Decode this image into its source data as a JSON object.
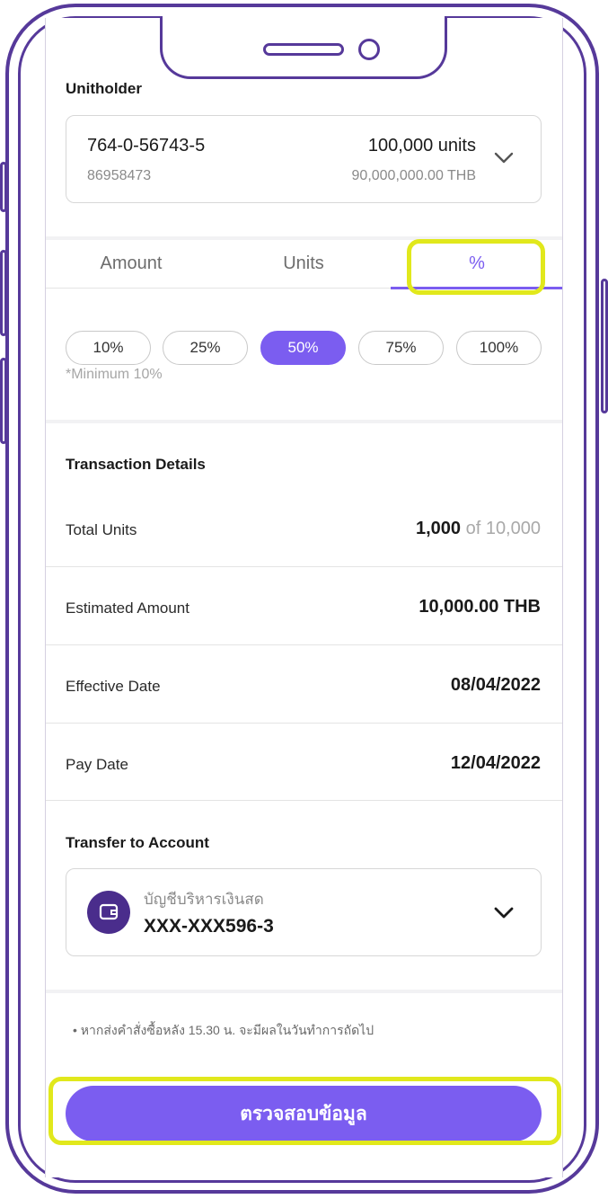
{
  "unitholder": {
    "title": "Unitholder",
    "account_number": "764-0-56743-5",
    "account_sub": "86958473",
    "units": "100,000 units",
    "value": "90,000,000.00 THB"
  },
  "tabs": [
    "Amount",
    "Units",
    "%"
  ],
  "active_tab": "%",
  "percent_options": [
    "10%",
    "25%",
    "50%",
    "75%",
    "100%"
  ],
  "selected_percent": "50%",
  "minimum_note": "*Minimum 10%",
  "transaction": {
    "title": "Transaction Details",
    "total_units_label": "Total Units",
    "total_units_value": "1,000",
    "total_units_of": "of 10,000",
    "estimated_amount_label": "Estimated Amount",
    "estimated_amount_value": "10,000.00 THB",
    "effective_date_label": "Effective Date",
    "effective_date_value": "08/04/2022",
    "pay_date_label": "Pay Date",
    "pay_date_value": "12/04/2022"
  },
  "transfer": {
    "title": "Transfer to Account",
    "account_type": "บัญชีบริหารเงินสด",
    "account_number": "XXX-XXX596-3"
  },
  "footnote": "หากส่งคำสั่งซื้อหลัง 15.30 น. จะมีผลในวันทำการถัดไป",
  "submit_label": "ตรวจสอบข้อมูล",
  "colors": {
    "accent": "#7b5df0",
    "frame": "#56399a",
    "highlight": "#e1e81c"
  }
}
